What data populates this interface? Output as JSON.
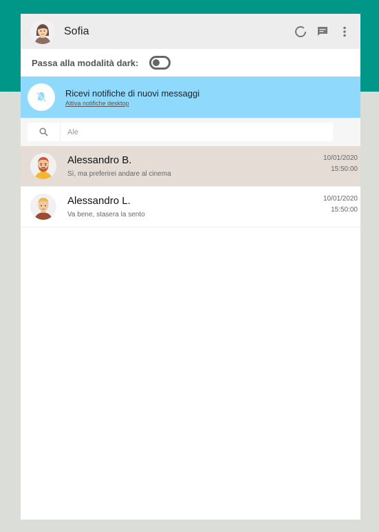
{
  "user": {
    "name": "Sofia"
  },
  "header_icons": [
    "status-icon",
    "chat-icon",
    "menu-dots-icon"
  ],
  "dark_mode": {
    "label": "Passa alla modalità dark:",
    "enabled": false
  },
  "notification": {
    "title": "Ricevi notifiche di nuovi messaggi",
    "link": "Attiva notifiche desktop",
    "icon": "bell-off-icon"
  },
  "search": {
    "value": "Ale",
    "placeholder": "Ale",
    "icon": "search-icon"
  },
  "contacts": [
    {
      "name": "Alessandro B.",
      "last_message": "Sì, ma preferirei andare al cinema",
      "date": "10/01/2020",
      "time": "15:50:00",
      "active": true
    },
    {
      "name": "Alessandro L.",
      "last_message": "Va bene, stasera la sento",
      "date": "10/01/2020",
      "time": "15:50:00",
      "active": false
    }
  ],
  "colors": {
    "accent": "#009688",
    "banner": "#8ed9fc",
    "active_row": "#e5ddd5",
    "background": "#dbddd9"
  }
}
